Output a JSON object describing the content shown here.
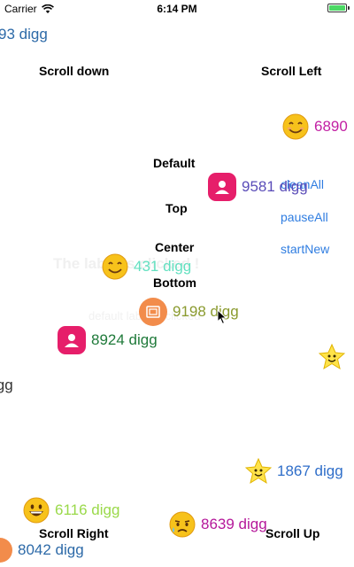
{
  "status": {
    "carrier": "Carrier",
    "time": "6:14 PM"
  },
  "buttons": {
    "scroll_down": "Scroll down",
    "scroll_left": "Scroll Left",
    "default": "Default",
    "top": "Top",
    "center": "Center",
    "bottom": "Bottom",
    "scroll_right": "Scroll Right",
    "scroll_up": "Scroll Up"
  },
  "actions": {
    "clean_all": "cleanAll",
    "pause_all": "pauseAll",
    "start_new": "startNew"
  },
  "ghost": {
    "clicked": "The label is clicked !",
    "sub": "default label is clicked"
  },
  "danmaku": [
    {
      "text": "93 digg",
      "color": "#2d6aa8"
    },
    {
      "text": "6890",
      "color": "#c21fa3"
    },
    {
      "text": "9581 digg",
      "color": "#5a4cb8"
    },
    {
      "text": "431 digg",
      "color": "#63e0c0"
    },
    {
      "text": "9198 digg",
      "color": "#8a9a2e"
    },
    {
      "text": "8924 digg",
      "color": "#1f7a3a"
    },
    {
      "text": "igg",
      "color": "#333333"
    },
    {
      "text": "1867 digg",
      "color": "#2f6ec9"
    },
    {
      "text": "6116 digg",
      "color": "#9ad94a"
    },
    {
      "text": "8639 digg",
      "color": "#b5189a"
    },
    {
      "text": "8042 digg",
      "color": "#2d6aa8"
    }
  ],
  "icons": [
    "wifi-icon",
    "battery-icon",
    "smile-emoji",
    "star-emoji",
    "grin-emoji",
    "sweat-emoji",
    "user-avatar",
    "photo-avatar"
  ]
}
